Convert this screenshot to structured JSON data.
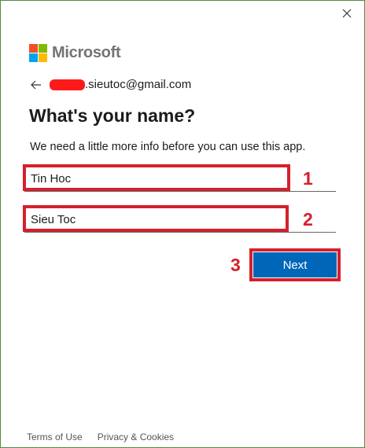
{
  "window": {
    "close_icon": "close-icon"
  },
  "brand": {
    "wordmark": "Microsoft",
    "logo_colors": [
      "#f25022",
      "#7fba00",
      "#00a4ef",
      "#ffb900"
    ]
  },
  "account": {
    "email_suffix": ".sieutoc@gmail.com",
    "back_icon": "arrow-left-icon"
  },
  "page": {
    "title": "What's your name?",
    "subtitle": "We need a little more info before you can use this app."
  },
  "form": {
    "first_name_value": "Tin Hoc",
    "last_name_value": "Sieu Toc",
    "next_label": "Next"
  },
  "annotations": {
    "step1": "1",
    "step2": "2",
    "step3": "3",
    "color": "#d5202c"
  },
  "footer": {
    "terms": "Terms of Use",
    "privacy": "Privacy & Cookies"
  },
  "colors": {
    "accent": "#0067b8"
  }
}
